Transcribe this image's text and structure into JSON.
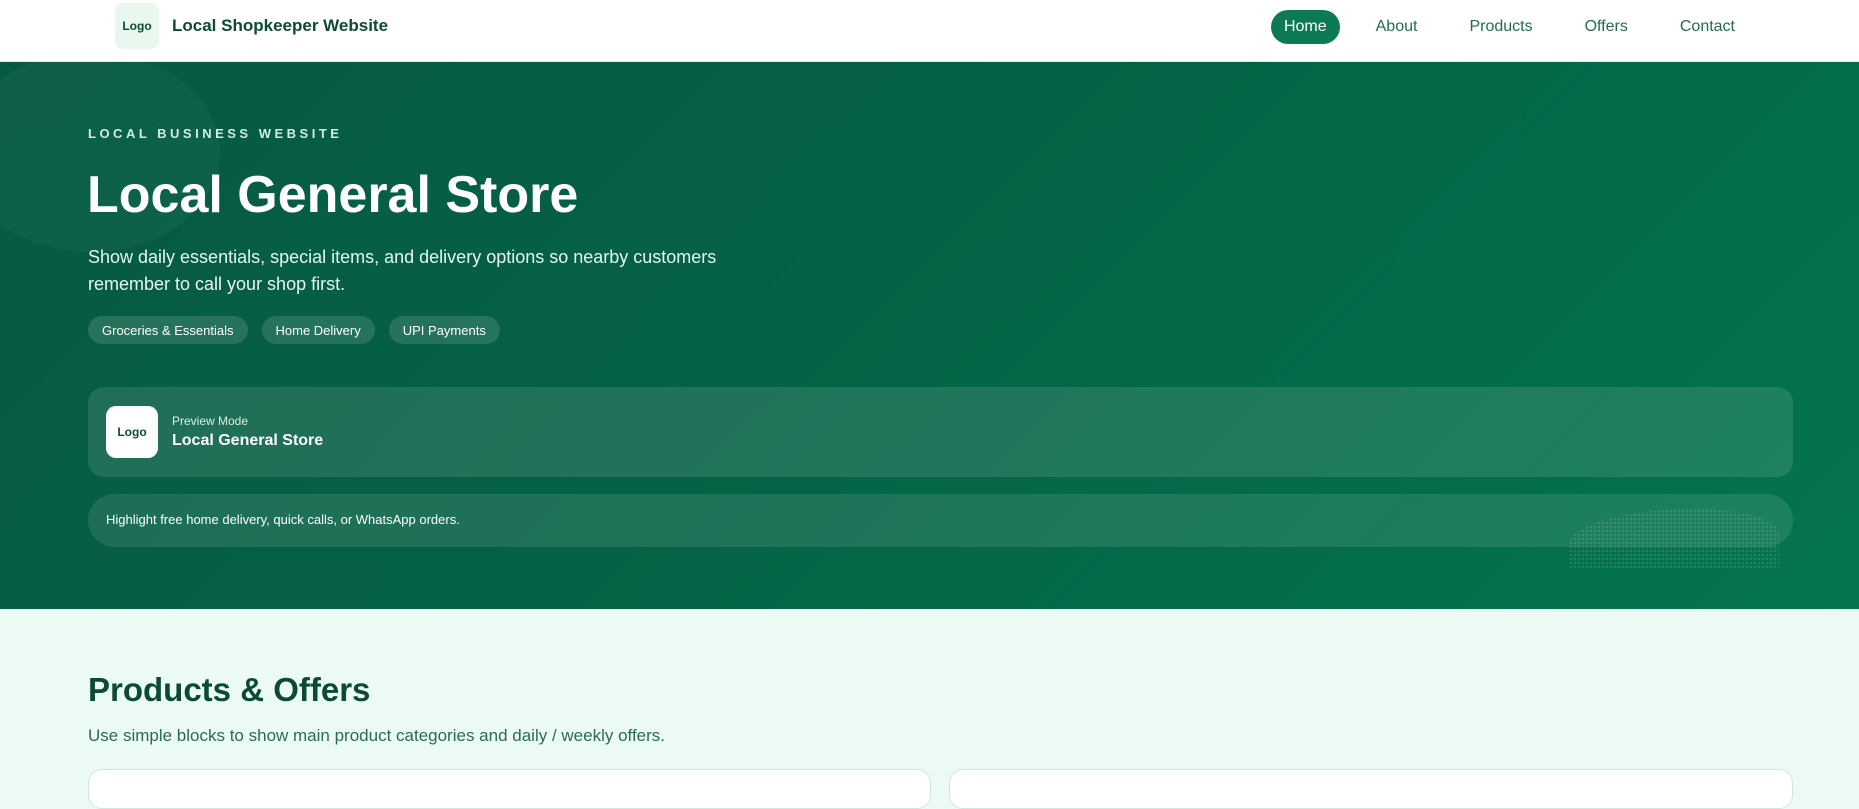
{
  "header": {
    "logo_text": "Logo",
    "site_title": "Local Shopkeeper Website",
    "nav": [
      {
        "label": "Home",
        "active": true
      },
      {
        "label": "About",
        "active": false
      },
      {
        "label": "Products",
        "active": false
      },
      {
        "label": "Offers",
        "active": false
      },
      {
        "label": "Contact",
        "active": false
      }
    ]
  },
  "hero": {
    "eyebrow": "LOCAL BUSINESS WEBSITE",
    "title": "Local General Store",
    "description": "Show daily essentials, special items, and delivery options so nearby customers remember to call your shop first.",
    "tags": [
      "Groceries & Essentials",
      "Home Delivery",
      "UPI Payments"
    ],
    "preview": {
      "logo_text": "Logo",
      "mode_label": "Preview Mode",
      "store_name": "Local General Store"
    },
    "highlight": "Highlight free home delivery, quick calls, or WhatsApp orders."
  },
  "products": {
    "title": "Products & Offers",
    "description": "Use simple blocks to show main product categories and daily / weekly offers."
  },
  "colors": {
    "primary": "#0c7a55",
    "hero_dark": "#065a42",
    "page_bg": "#ebfaf3",
    "text_dark": "#0b4a36"
  }
}
